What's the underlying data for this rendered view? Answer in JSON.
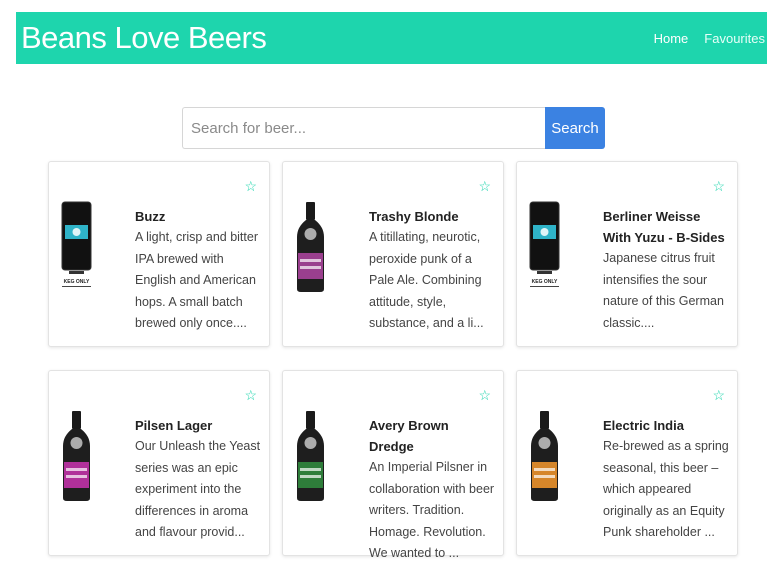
{
  "header": {
    "brand": "Beans Love Beers",
    "nav": {
      "home": "Home",
      "favourites": "Favourites"
    }
  },
  "search": {
    "placeholder": "Search for beer...",
    "button": "Search"
  },
  "beers": [
    {
      "name": "Buzz",
      "description": "A light, crisp and bitter IPA brewed with English and American hops. A small batch brewed only once....",
      "bottle": "can"
    },
    {
      "name": "Trashy Blonde",
      "description": "A titillating, neurotic, peroxide punk of a Pale Ale. Combining attitude, style, substance, and a li...",
      "bottle": "purple"
    },
    {
      "name": "Berliner Weisse With Yuzu - B-Sides",
      "description": "Japanese citrus fruit intensifies the sour nature of this German classic....",
      "bottle": "can"
    },
    {
      "name": "Pilsen Lager",
      "description": "Our Unleash the Yeast series was an epic experiment into the differences in aroma and flavour provid...",
      "bottle": "magenta"
    },
    {
      "name": "Avery Brown Dredge",
      "description": "An Imperial Pilsner in collaboration with beer writers. Tradition. Homage. Revolution. We wanted to ...",
      "bottle": "green"
    },
    {
      "name": "Electric India",
      "description": "Re-brewed as a spring seasonal, this beer – which appeared originally as an Equity Punk shareholder ...",
      "bottle": "orange"
    }
  ],
  "can_label": "KEG ONLY",
  "colors": {
    "accent": "#1ed5ad",
    "button": "#3b82e2"
  },
  "icons": {
    "favourite": "star-outline-icon"
  }
}
